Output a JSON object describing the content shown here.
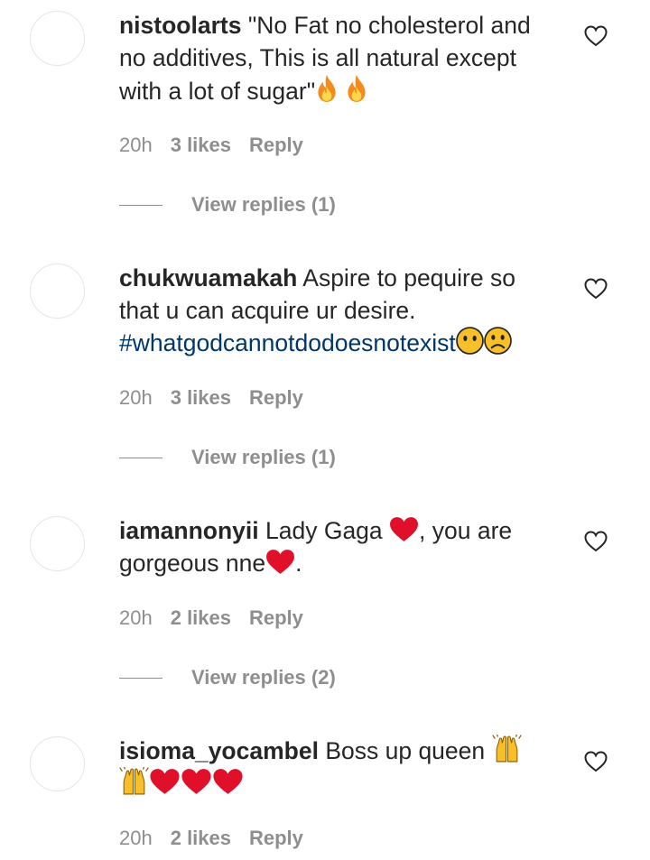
{
  "comments": [
    {
      "username": "nistoolarts",
      "text": "\"No Fat no cholesterol and no additives, This is all natural except with a lot of sugar\"",
      "emoji": [
        "fire",
        "fire"
      ],
      "time": "20h",
      "likes": "3 likes",
      "reply": "Reply",
      "view_replies": "View replies (1)"
    },
    {
      "username": "chukwuamakah",
      "text": "Aspire to pequire so that u can acquire ur desire.",
      "hashtag": "#whatgodcannotdodoesnotexist",
      "emoji": [
        "no-mouth-face",
        "frowning-face"
      ],
      "time": "20h",
      "likes": "3 likes",
      "reply": "Reply",
      "view_replies": "View replies (1)"
    },
    {
      "username": "iamannonyii",
      "text_a": "Lady Gaga",
      "text_b": ", you are gorgeous nne",
      "text_c": ".",
      "emoji": [
        "red-heart",
        "red-heart"
      ],
      "time": "20h",
      "likes": "2 likes",
      "reply": "Reply",
      "view_replies": "View replies (2)"
    },
    {
      "username": "isioma_yocambel",
      "text": "Boss up queen",
      "emoji": [
        "raising-hands",
        "raising-hands",
        "red-heart",
        "red-heart",
        "red-heart"
      ],
      "time": "20h",
      "likes": "2 likes",
      "reply": "Reply"
    }
  ],
  "icons": {
    "like": "heart-outline-icon"
  },
  "colors": {
    "text": "#262626",
    "secondary": "#8e8e8e",
    "hashtag": "#00376b",
    "heart_red": "#e0102b",
    "fire_orange": "#f48b1d",
    "emoji_yellow": "#f7c02b"
  }
}
